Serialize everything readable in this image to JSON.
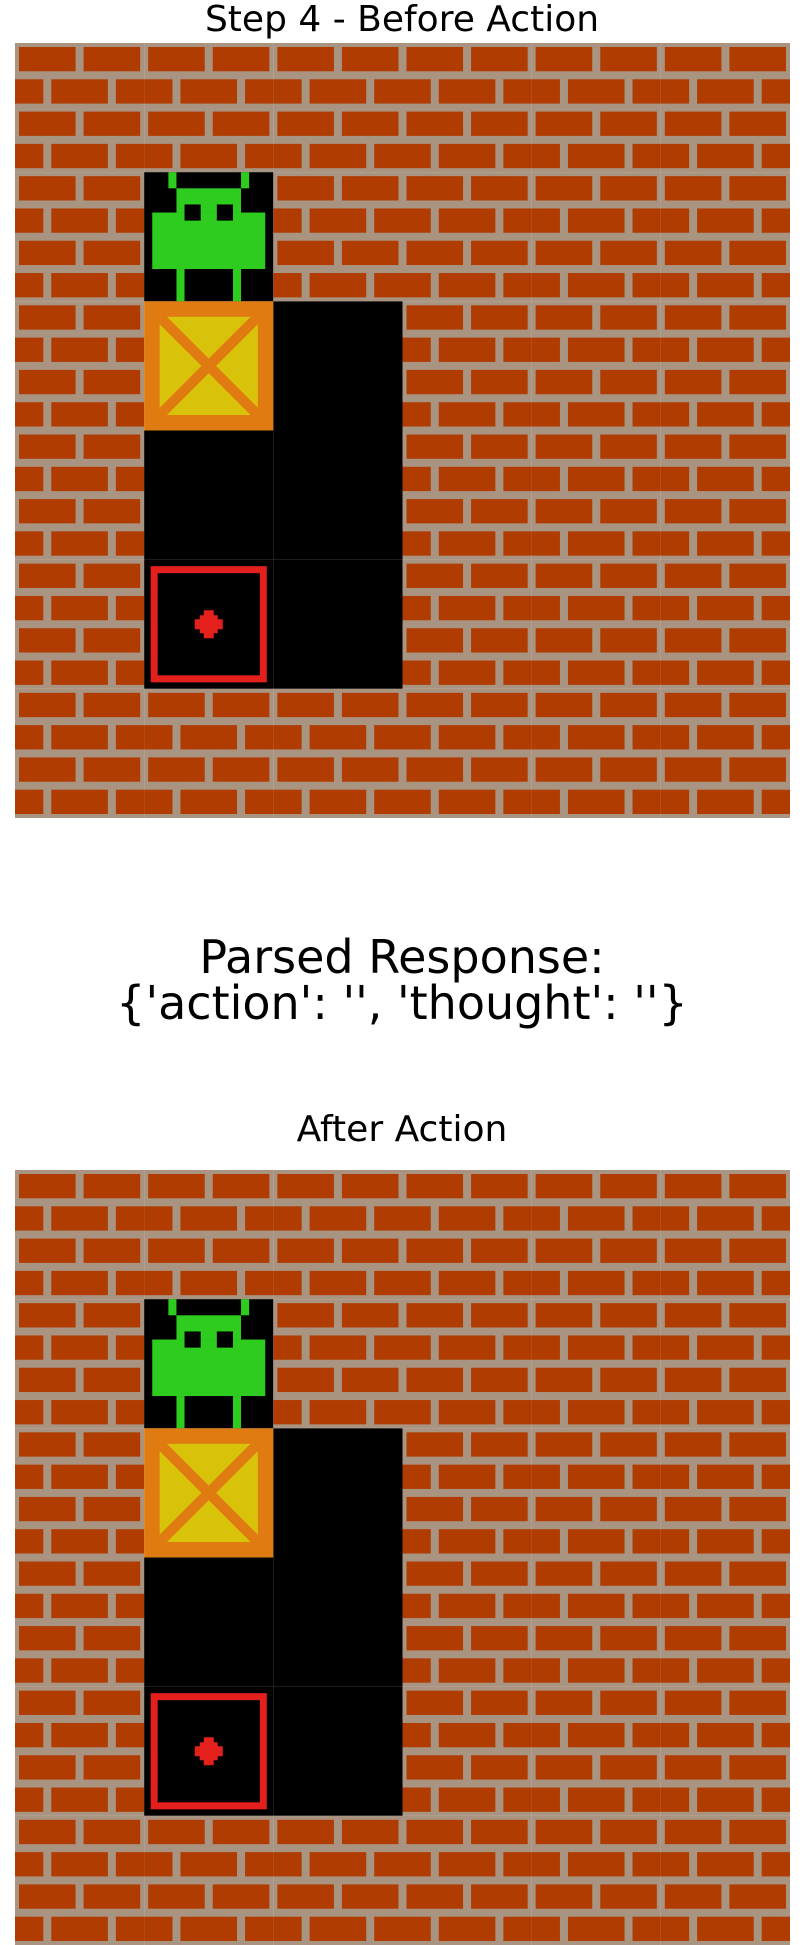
{
  "top_panel": {
    "title": "Step 4 - Before Action"
  },
  "response": {
    "line1": "Parsed Response:",
    "line2": "{'action': '', 'thought': ''}"
  },
  "bottom_panel": {
    "title": "After Action"
  },
  "game": {
    "grid_size": [
      6,
      6
    ],
    "legend": [
      "wall",
      "floor",
      "player",
      "box",
      "target"
    ],
    "layout_rows": [
      [
        "wall",
        "wall",
        "wall",
        "wall",
        "wall",
        "wall"
      ],
      [
        "wall",
        "player",
        "wall",
        "wall",
        "wall",
        "wall"
      ],
      [
        "wall",
        "box",
        "floor",
        "wall",
        "wall",
        "wall"
      ],
      [
        "wall",
        "floor",
        "floor",
        "wall",
        "wall",
        "wall"
      ],
      [
        "wall",
        "target",
        "floor",
        "wall",
        "wall",
        "wall"
      ],
      [
        "wall",
        "wall",
        "wall",
        "wall",
        "wall",
        "wall"
      ]
    ]
  },
  "colors": {
    "brick": "#b03c02",
    "mortar": "#a99381",
    "floor": "#000000",
    "player": "#2ecc1f",
    "box_outer": "#e07b12",
    "box_inner": "#d9c20a",
    "target": "#e3201c"
  }
}
